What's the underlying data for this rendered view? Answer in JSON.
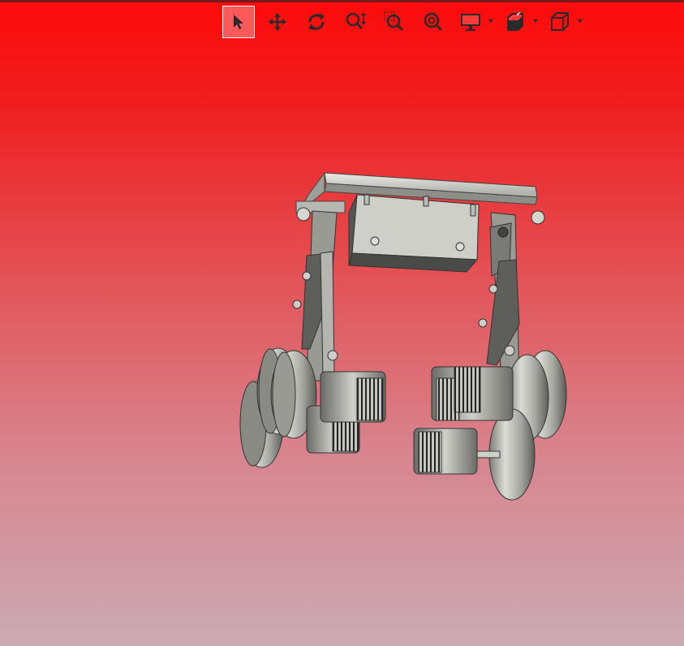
{
  "toolbar": {
    "tools": [
      {
        "name": "select",
        "icon": "arrow-cursor-icon",
        "active": true
      },
      {
        "name": "pan",
        "icon": "move-arrows-icon",
        "active": false
      },
      {
        "name": "rotate",
        "icon": "rotate-icon",
        "active": false
      },
      {
        "name": "zoom",
        "icon": "zoom-vertical-icon",
        "active": false
      },
      {
        "name": "zoom-window",
        "icon": "zoom-window-icon",
        "active": false
      },
      {
        "name": "zoom-fit",
        "icon": "zoom-fit-icon",
        "active": false
      },
      {
        "name": "display-mode",
        "icon": "monitor-icon",
        "dropdown": true
      },
      {
        "name": "section-view",
        "icon": "section-cube-icon",
        "dropdown": true
      },
      {
        "name": "view-orientation",
        "icon": "cube-icon",
        "dropdown": true
      }
    ]
  },
  "viewport": {
    "background_top": "#ff0a0a",
    "background_bottom": "#cbaab3",
    "model_color": "#c8c8c2"
  }
}
